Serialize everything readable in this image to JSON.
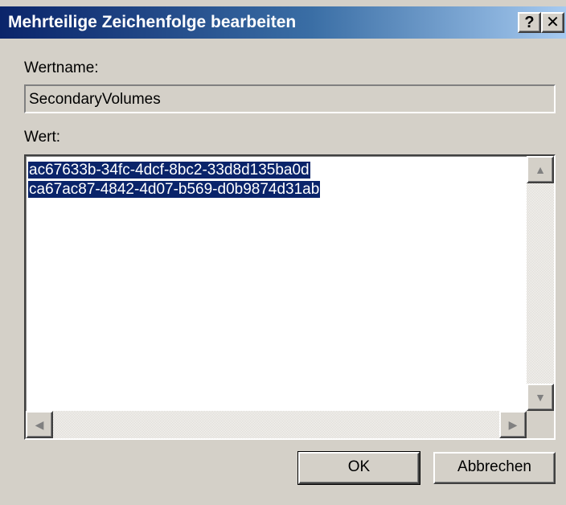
{
  "window": {
    "title": "Mehrteilige Zeichenfolge bearbeiten",
    "help_button": "?",
    "close_button": "✕"
  },
  "value_name": {
    "label": "Wertname:",
    "value": "SecondaryVolumes"
  },
  "value_data": {
    "label": "Wert:",
    "lines": [
      "ac67633b-34fc-4dcf-8bc2-33d8d135ba0d",
      "ca67ac87-4842-4d07-b569-d0b9874d31ab"
    ]
  },
  "buttons": {
    "ok": "OK",
    "cancel": "Abbrechen"
  },
  "colors": {
    "titlebar_start": "#0a246a",
    "titlebar_end": "#a6caf0",
    "selection": "#0a246a",
    "dialog_face": "#d4d0c8"
  }
}
